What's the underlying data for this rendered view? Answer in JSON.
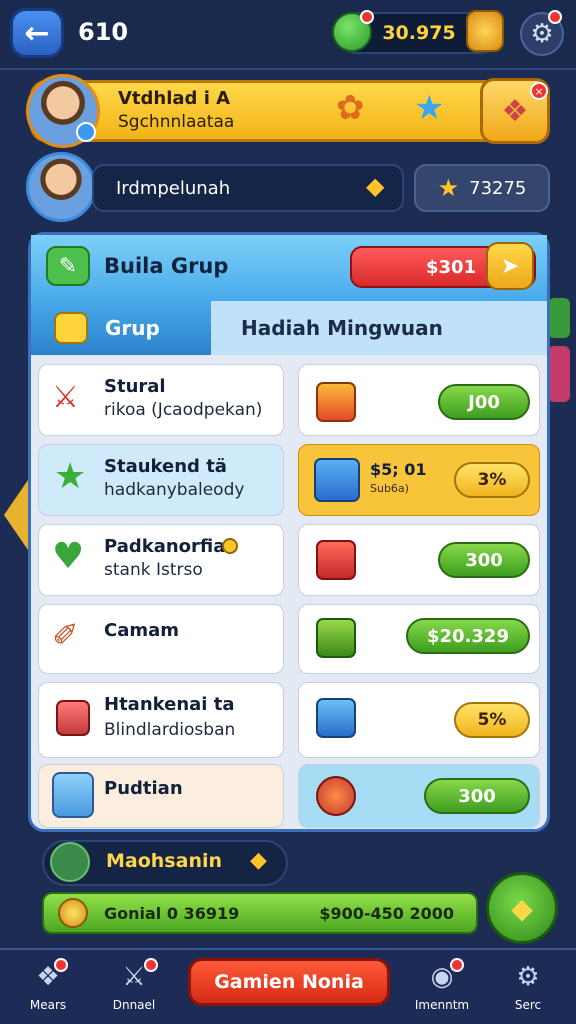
{
  "topbar": {
    "level": "610",
    "coins": "30.975"
  },
  "profile": {
    "name": "Vtdhlad i A",
    "subtitle": "Sgchnnlaataa"
  },
  "player": {
    "name": "Irdmpelunah",
    "score": "73275"
  },
  "panel": {
    "title": "Buila Grup",
    "red_value": "$301",
    "tabs": [
      {
        "label": "Grup"
      },
      {
        "label": "Hadiah Mingwuan"
      }
    ]
  },
  "rows": [
    {
      "title": "Stural",
      "subtitle": "rikoa (Jcaodpekan)",
      "reward_label": "J00",
      "icon": "crossed-tools-icon"
    },
    {
      "title": "Staukend tä",
      "subtitle": "hadkanybaleody",
      "reward_value": "$5; 01",
      "reward_sub": "Sub6a)",
      "reward_label": "3%",
      "icon": "green-star-icon"
    },
    {
      "title": "Padkanorfia",
      "subtitle": "stank Istrso",
      "reward_label": "300",
      "icon": "green-heart-icon"
    },
    {
      "title": "Camam",
      "subtitle": "",
      "reward_label": "$20.329",
      "icon": "brush-icon"
    },
    {
      "title": "Htankenai ta",
      "subtitle": "Blindlardiosban",
      "reward_label": "5%",
      "icon": "gift-box-icon"
    },
    {
      "title": "Pudtian",
      "subtitle": "",
      "reward_label": "300",
      "icon": "avatar-icon"
    }
  ],
  "bottom": {
    "label": "Maohsanin",
    "green_bar_left": "Gonial 0 36919",
    "green_bar_right": "$900-450 2000"
  },
  "nav": {
    "items": [
      {
        "label": "Mears"
      },
      {
        "label": "Dnnael"
      },
      {
        "label": "Imenntm"
      },
      {
        "label": "Serc"
      }
    ],
    "play_label": "Gamien Nonia"
  }
}
